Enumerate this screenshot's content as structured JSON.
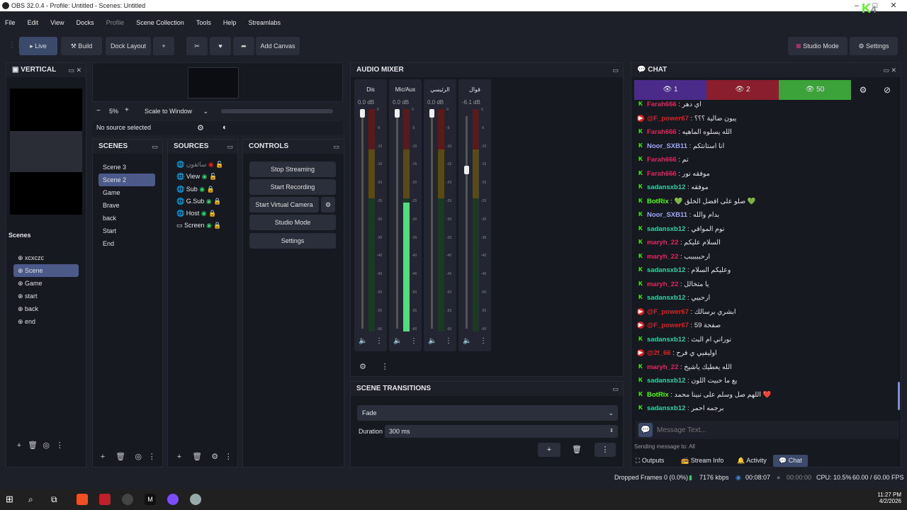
{
  "window": {
    "title": "OBS 32.0.4 - Profile: Untitled - Scenes: Untitled"
  },
  "menu": [
    "File",
    "Edit",
    "View",
    "Docks",
    "Profile",
    "Scene Collection",
    "Tools",
    "Help",
    "Streamlabs"
  ],
  "toolbar": {
    "live": "Live",
    "build": "Build",
    "dock_layout": "Dock Layout",
    "plus": "+",
    "add_canvas": "Add Canvas",
    "studio_mode": "Studio Mode",
    "settings": "Settings"
  },
  "vertical": {
    "title": "VERTICAL",
    "scenes_label": "Scenes",
    "scenes": [
      "xcxczc",
      "Scene",
      "Game",
      "start",
      "back",
      "end"
    ],
    "selected": "Scene"
  },
  "preview": {
    "zoom": "5%",
    "scale": "Scale to Window",
    "no_source": "No source selected"
  },
  "scenes": {
    "title": "SCENES",
    "items": [
      "Scene 3",
      "Scene 2",
      "Game",
      "Brave",
      "back",
      "Start",
      "End"
    ],
    "selected": "Scene 2"
  },
  "sources": {
    "title": "SOURCES",
    "items": [
      "سائقون",
      "View",
      "Sub",
      "G.Sub",
      "Host",
      "Screen"
    ]
  },
  "controls": {
    "title": "CONTROLS",
    "stop_streaming": "Stop Streaming",
    "start_recording": "Start Recording",
    "start_virtual": "Start Virtual Camera",
    "studio_mode": "Studio Mode",
    "settings": "Settings"
  },
  "audio": {
    "title": "AUDIO MIXER",
    "channels": [
      {
        "name": "Dis",
        "db": "0.0 dB"
      },
      {
        "name": "Mic/Aux",
        "db": "0.0 dB"
      },
      {
        "name": "الرئيسي",
        "db": "0.0 dB"
      },
      {
        "name": "قوال",
        "db": "-6.1 dB"
      }
    ],
    "ticks": [
      "0",
      "-5",
      "-10",
      "-15",
      "-20",
      "-25",
      "-30",
      "-35",
      "-40",
      "-45",
      "-50",
      "-55",
      "-60"
    ]
  },
  "transitions": {
    "title": "SCENE TRANSITIONS",
    "type": "Fade",
    "duration_label": "Duration",
    "duration": "300 ms"
  },
  "chat": {
    "title": "CHAT",
    "viewers": [
      "1",
      "2",
      "50"
    ],
    "placeholder": "Message Text...",
    "sending": "Sending message to: All",
    "messages": [
      {
        "p": "k",
        "u": "Farah666",
        "c": "#e0245e",
        "t": ": اي دهر"
      },
      {
        "p": "y",
        "u": "@F_power67",
        "c": "#e02020",
        "t": ": يبون ضالية ؟؟؟"
      },
      {
        "p": "k",
        "u": "Farah666",
        "c": "#e0245e",
        "t": ": الله يسلوه الماهيه"
      },
      {
        "p": "k",
        "u": "Noor_SXB11",
        "c": "#a0a8f0",
        "t": ": انا استانتكم"
      },
      {
        "p": "k",
        "u": "Farah666",
        "c": "#e0245e",
        "t": ": تم"
      },
      {
        "p": "k",
        "u": "Farah666",
        "c": "#e0245e",
        "t": ": موفقه نور"
      },
      {
        "p": "k",
        "u": "sadansxb12",
        "c": "#2dd4a0",
        "t": ": موفقه"
      },
      {
        "p": "k",
        "u": "BotRix",
        "c": "#53fc18",
        "t": ": 💚 صلو على افضل الخلق 💚"
      },
      {
        "p": "k",
        "u": "Noor_SXB11",
        "c": "#a0a8f0",
        "t": ": بدام والله"
      },
      {
        "p": "k",
        "u": "sadansxb12",
        "c": "#2dd4a0",
        "t": ": نوم الموافي"
      },
      {
        "p": "k",
        "u": "maryh_22",
        "c": "#e0245e",
        "t": ": السلام عليكم"
      },
      {
        "p": "k",
        "u": "maryh_22",
        "c": "#e0245e",
        "t": ": ارحبببببب"
      },
      {
        "p": "k",
        "u": "sadansxb12",
        "c": "#2dd4a0",
        "t": ": وعليكم السلام"
      },
      {
        "p": "k",
        "u": "maryh_22",
        "c": "#e0245e",
        "t": ": يا متخالل"
      },
      {
        "p": "k",
        "u": "sadansxb12",
        "c": "#2dd4a0",
        "t": ": ارحبيي"
      },
      {
        "p": "y",
        "u": "@F_power67",
        "c": "#e02020",
        "t": ": ابشري برسالك"
      },
      {
        "p": "y",
        "u": "@F_power67",
        "c": "#e02020",
        "t": ": صفحة 59"
      },
      {
        "p": "k",
        "u": "sadansxb12",
        "c": "#2dd4a0",
        "t": ": نوراني ام البث"
      },
      {
        "p": "y",
        "u": "@2f_66",
        "c": "#e02020",
        "t": ": اوليفيي ي فرح"
      },
      {
        "p": "k",
        "u": "maryh_22",
        "c": "#e0245e",
        "t": ": الله يعطيك ياشيخ"
      },
      {
        "p": "k",
        "u": "sadansxb12",
        "c": "#2dd4a0",
        "t": ": يع ما حبيت اللون"
      },
      {
        "p": "k",
        "u": "BotRix",
        "c": "#53fc18",
        "t": ": اللهم صل وسلم على نبينا محمد ❤️"
      },
      {
        "p": "k",
        "u": "sadansxb12",
        "c": "#2dd4a0",
        "t": ": برجمه احمر"
      }
    ],
    "tabs": [
      "Outputs",
      "Stream Info",
      "Activity",
      "Chat"
    ]
  },
  "status": {
    "dropped": "Dropped Frames 0 (0.0%)",
    "kbps": "7176 kbps",
    "live_time": "00:08:07",
    "rec_time": "00:00:00",
    "cpu": "CPU: 10.5%",
    "fps": "60.00 / 60.00 FPS"
  },
  "taskbar": {
    "time": "11:27 PM",
    "date": "4/2/2026"
  }
}
